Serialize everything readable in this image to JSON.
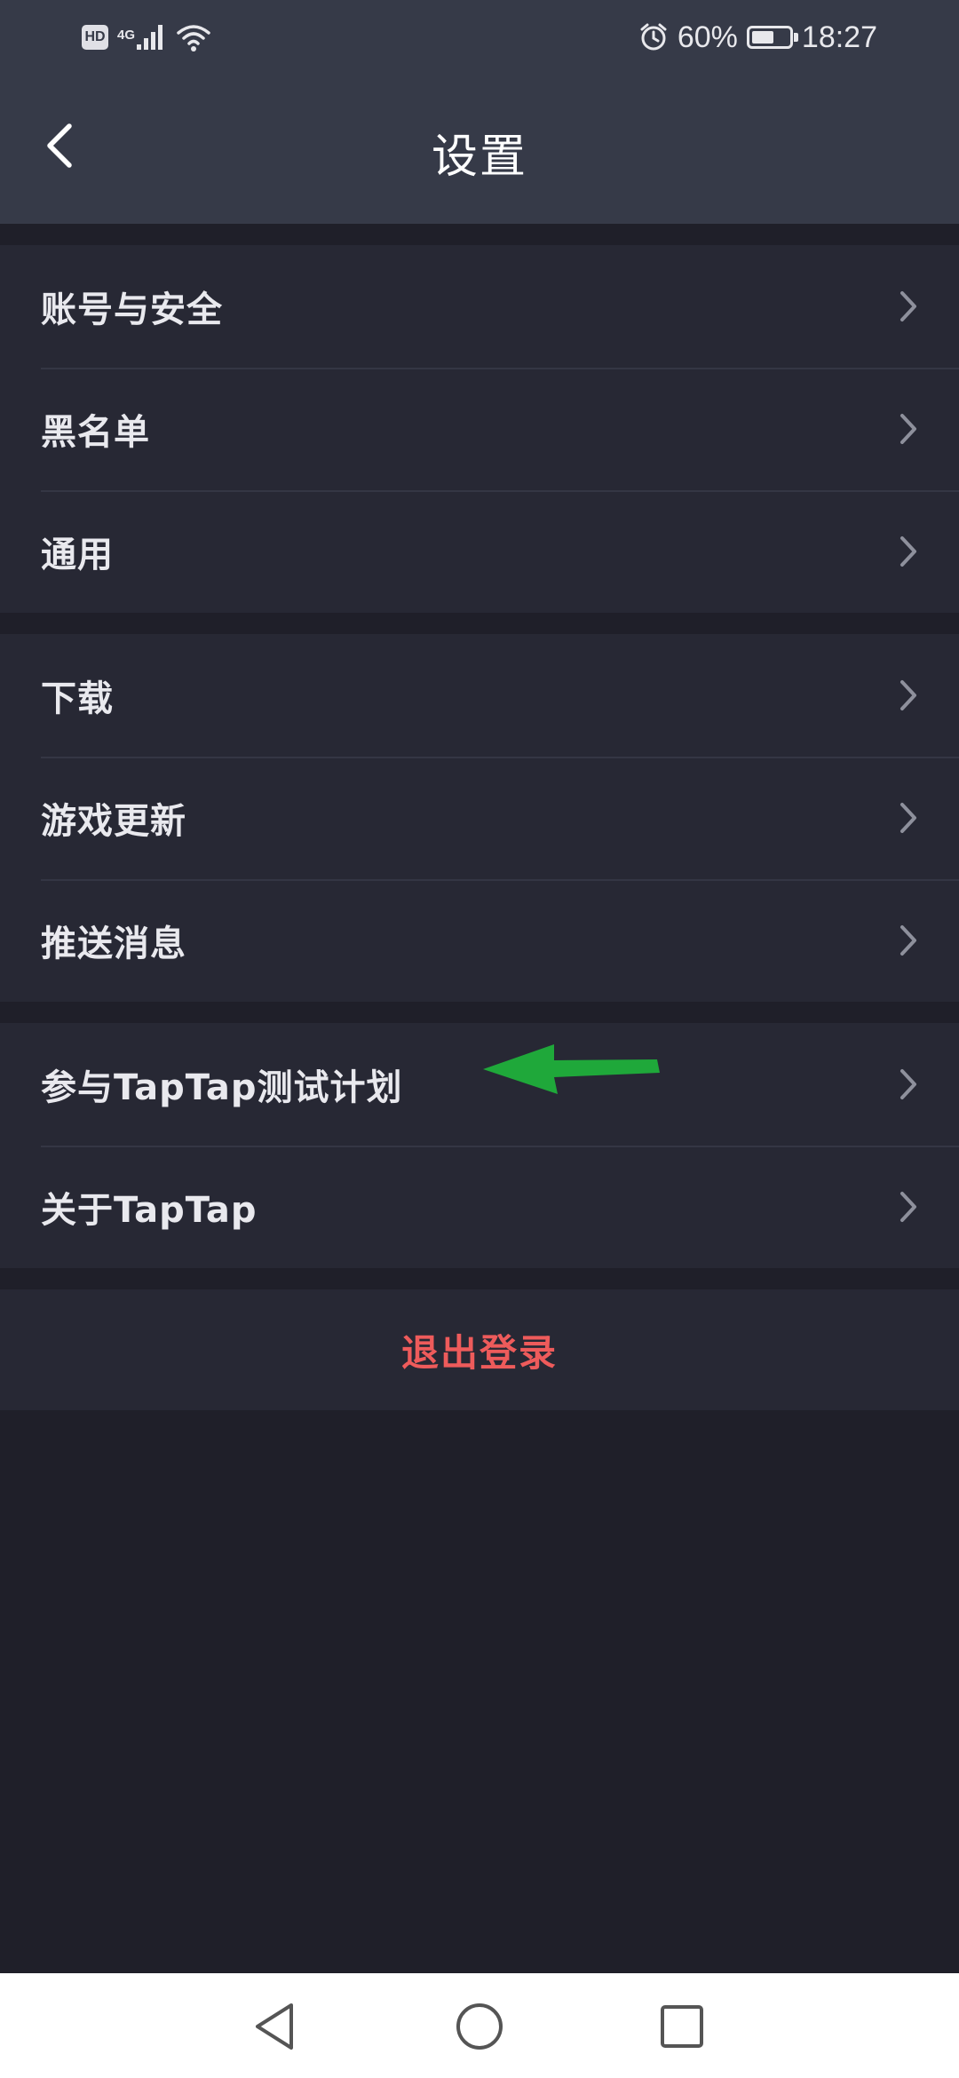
{
  "status_bar": {
    "hd_badge": "HD",
    "network_type": "4G",
    "icons": {
      "signal": "signal-icon",
      "wifi": "wifi-icon",
      "alarm": "alarm-icon",
      "battery": "battery-icon"
    },
    "battery_percent_text": "60%",
    "battery_level": 0.6,
    "time": "18:27"
  },
  "header": {
    "title": "设置",
    "back_icon": "chevron-left-icon"
  },
  "groups": [
    {
      "items": [
        {
          "label": "账号与安全"
        },
        {
          "label": "黑名单"
        },
        {
          "label": "通用"
        }
      ]
    },
    {
      "items": [
        {
          "label": "下载"
        },
        {
          "label": "游戏更新"
        },
        {
          "label": "推送消息"
        }
      ]
    },
    {
      "items": [
        {
          "label": "参与TapTap测试计划"
        },
        {
          "label": "关于TapTap"
        }
      ]
    }
  ],
  "logout": {
    "label": "退出登录"
  },
  "annotation": {
    "icon": "arrow-left-icon",
    "color": "#1fa83a"
  },
  "nav_bar": {
    "back_icon": "triangle-back-icon",
    "home_icon": "circle-home-icon",
    "recents_icon": "square-recents-icon"
  },
  "colors": {
    "header_bg": "#363a48",
    "page_bg": "#1f1f29",
    "row_bg": "#272834",
    "text": "#e9e9ee",
    "logout": "#ee5b5b"
  }
}
